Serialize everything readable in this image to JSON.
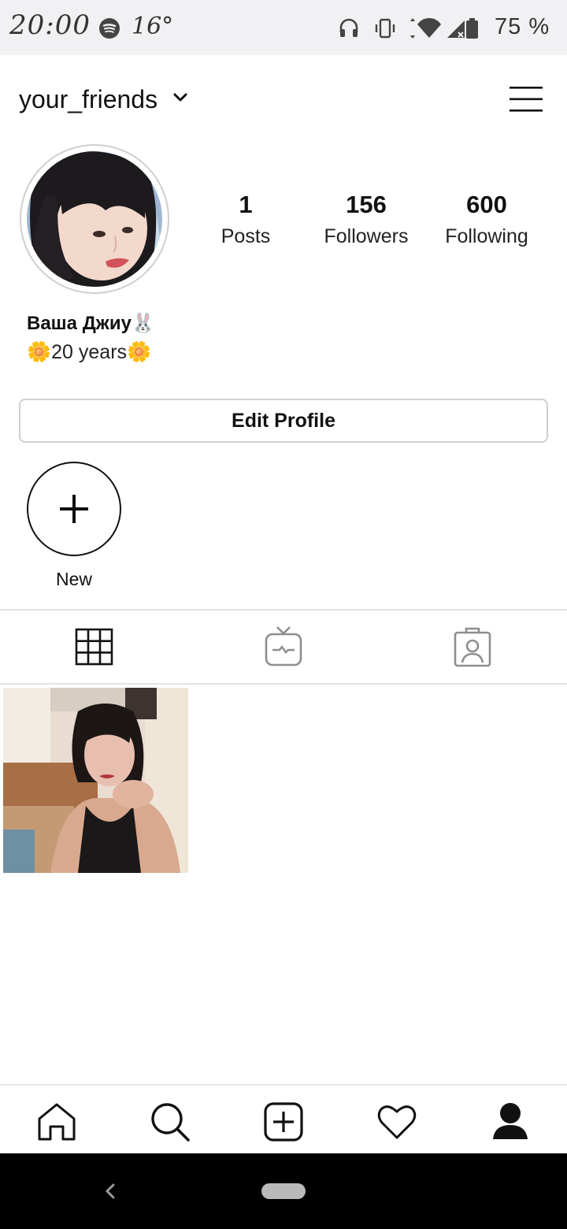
{
  "status_bar": {
    "time": "20:00",
    "temperature": "16°",
    "battery": "75 %",
    "icons": [
      "spotify-icon",
      "headphones-icon",
      "vibrate-icon",
      "wifi-icon",
      "signal-icon",
      "battery-icon"
    ]
  },
  "header": {
    "username": "your_friends",
    "icons": [
      "chevron-down-icon",
      "menu-icon"
    ]
  },
  "profile": {
    "stats": [
      {
        "value": "1",
        "label": "Posts"
      },
      {
        "value": "156",
        "label": "Followers"
      },
      {
        "value": "600",
        "label": "Following"
      }
    ],
    "display_name": "Ваша Джиу🐰",
    "bio": "🌼20 years🌼",
    "edit_button": "Edit Profile"
  },
  "highlights": {
    "new_label": "New"
  },
  "tabs": [
    "grid-icon",
    "igtv-icon",
    "tagged-icon"
  ],
  "bottom_nav": [
    "home-icon",
    "search-icon",
    "add-post-icon",
    "heart-icon",
    "profile-icon"
  ],
  "colors": {
    "status_bar_bg": "#f1f1f3",
    "text": "#111111",
    "border": "#cfcfcf",
    "inactive_icon": "#8e8e8e",
    "system_nav_bg": "#000000"
  }
}
